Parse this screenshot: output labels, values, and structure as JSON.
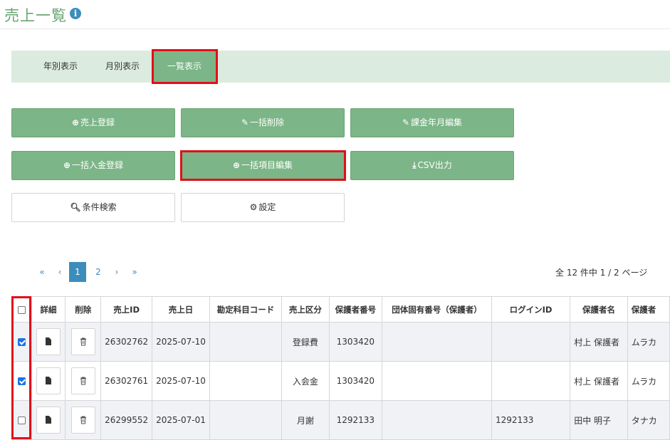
{
  "header": {
    "title": "売上一覧",
    "info_icon": "i"
  },
  "tabs": [
    {
      "label": "年別表示"
    },
    {
      "label": "月別表示"
    },
    {
      "label": "一覧表示"
    }
  ],
  "buttons": {
    "register_sales": "売上登録",
    "bulk_delete": "一括削除",
    "edit_billing_month": "課金年月編集",
    "bulk_deposit": "一括入金登録",
    "bulk_item_edit": "一括項目編集",
    "csv_export": "CSV出力",
    "condition_search": "条件検索",
    "settings": "設定"
  },
  "pagination": {
    "first": "«",
    "prev": "‹",
    "pages": [
      "1",
      "2"
    ],
    "current": "1",
    "next": "›",
    "last": "»",
    "summary": "全 12 件中 1 / 2 ページ"
  },
  "table": {
    "headers": [
      "詳細",
      "削除",
      "売上ID",
      "売上日",
      "勘定科目コード",
      "売上区分",
      "保護者番号",
      "団体固有番号（保護者）",
      "ログインID",
      "保護者名",
      "保護者"
    ],
    "rows": [
      {
        "checked": true,
        "sales_id": "26302762",
        "date": "2025-07-10",
        "account_code": "",
        "category": "登録費",
        "guardian_no": "1303420",
        "org_no": "",
        "login_id": "",
        "name": "村上 保護者",
        "kana": "ムラカ"
      },
      {
        "checked": true,
        "sales_id": "26302761",
        "date": "2025-07-10",
        "account_code": "",
        "category": "入会金",
        "guardian_no": "1303420",
        "org_no": "",
        "login_id": "",
        "name": "村上 保護者",
        "kana": "ムラカ"
      },
      {
        "checked": false,
        "sales_id": "26299552",
        "date": "2025-07-01",
        "account_code": "",
        "category": "月謝",
        "guardian_no": "1292133",
        "org_no": "",
        "login_id": "1292133",
        "name": "田中 明子",
        "kana": "タナカ"
      }
    ]
  },
  "colors": {
    "accent_green": "#7cb587",
    "tab_bar": "#dcebdf",
    "highlight": "#e0101a",
    "link": "#3c8dbc"
  }
}
